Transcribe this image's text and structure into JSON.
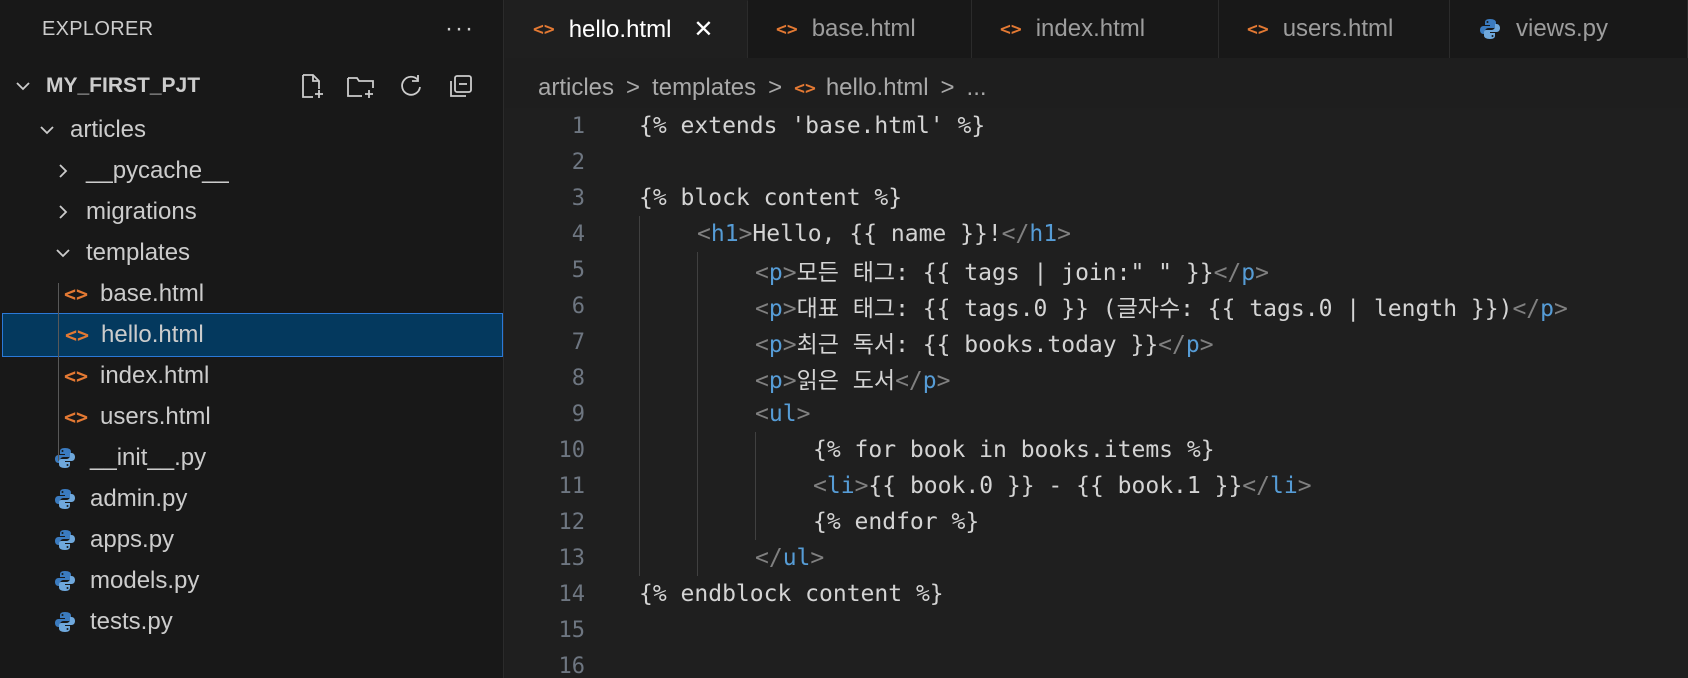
{
  "explorer": {
    "title": "EXPLORER",
    "more": "···",
    "project": "MY_FIRST_PJT",
    "actions": [
      "new-file-icon",
      "new-folder-icon",
      "refresh-icon",
      "collapse-all-icon"
    ],
    "tree": [
      {
        "label": "articles",
        "type": "folder-open",
        "indent": 1
      },
      {
        "label": "__pycache__",
        "type": "folder-closed",
        "indent": 2
      },
      {
        "label": "migrations",
        "type": "folder-closed",
        "indent": 2
      },
      {
        "label": "templates",
        "type": "folder-open",
        "indent": 2
      },
      {
        "label": "base.html",
        "type": "html",
        "indent": 3
      },
      {
        "label": "hello.html",
        "type": "html",
        "indent": 3,
        "selected": true
      },
      {
        "label": "index.html",
        "type": "html",
        "indent": 3
      },
      {
        "label": "users.html",
        "type": "html",
        "indent": 3
      },
      {
        "label": "__init__.py",
        "type": "py",
        "indent": 2
      },
      {
        "label": "admin.py",
        "type": "py",
        "indent": 2
      },
      {
        "label": "apps.py",
        "type": "py",
        "indent": 2
      },
      {
        "label": "models.py",
        "type": "py",
        "indent": 2
      },
      {
        "label": "tests.py",
        "type": "py",
        "indent": 2
      }
    ]
  },
  "tabs": [
    {
      "label": "hello.html",
      "type": "html",
      "active": true,
      "close": "✕"
    },
    {
      "label": "base.html",
      "type": "html"
    },
    {
      "label": "index.html",
      "type": "html"
    },
    {
      "label": "users.html",
      "type": "html"
    },
    {
      "label": "views.py",
      "type": "py"
    }
  ],
  "breadcrumb": {
    "parts": [
      "articles",
      "templates"
    ],
    "file": "hello.html",
    "tail": "...",
    "sep": ">"
  },
  "editor": {
    "lines": [
      {
        "n": "1",
        "indent": 0,
        "tokens": [
          [
            "t",
            "{% extends 'base.html' %}"
          ]
        ]
      },
      {
        "n": "2",
        "indent": 0,
        "tokens": []
      },
      {
        "n": "3",
        "indent": 0,
        "tokens": [
          [
            "t",
            "{% block content %}"
          ]
        ]
      },
      {
        "n": "4",
        "indent": 1,
        "tokens": [
          [
            "b",
            "<"
          ],
          [
            "g",
            "h1"
          ],
          [
            "b",
            ">"
          ],
          [
            "t",
            "Hello, {{ name }}!"
          ],
          [
            "b",
            "</"
          ],
          [
            "g",
            "h1"
          ],
          [
            "b",
            ">"
          ]
        ]
      },
      {
        "n": "5",
        "indent": 2,
        "tokens": [
          [
            "b",
            "<"
          ],
          [
            "g",
            "p"
          ],
          [
            "b",
            ">"
          ],
          [
            "t",
            "모든 태그: {{ tags | join:\" \" }}"
          ],
          [
            "b",
            "</"
          ],
          [
            "g",
            "p"
          ],
          [
            "b",
            ">"
          ]
        ]
      },
      {
        "n": "6",
        "indent": 2,
        "tokens": [
          [
            "b",
            "<"
          ],
          [
            "g",
            "p"
          ],
          [
            "b",
            ">"
          ],
          [
            "t",
            "대표 태그: {{ tags.0 }} (글자수: {{ tags.0 | length }})"
          ],
          [
            "b",
            "</"
          ],
          [
            "g",
            "p"
          ],
          [
            "b",
            ">"
          ]
        ]
      },
      {
        "n": "7",
        "indent": 2,
        "tokens": [
          [
            "b",
            "<"
          ],
          [
            "g",
            "p"
          ],
          [
            "b",
            ">"
          ],
          [
            "t",
            "최근 독서: {{ books.today }}"
          ],
          [
            "b",
            "</"
          ],
          [
            "g",
            "p"
          ],
          [
            "b",
            ">"
          ]
        ]
      },
      {
        "n": "8",
        "indent": 2,
        "tokens": [
          [
            "b",
            "<"
          ],
          [
            "g",
            "p"
          ],
          [
            "b",
            ">"
          ],
          [
            "t",
            "읽은 도서"
          ],
          [
            "b",
            "</"
          ],
          [
            "g",
            "p"
          ],
          [
            "b",
            ">"
          ]
        ]
      },
      {
        "n": "9",
        "indent": 2,
        "tokens": [
          [
            "b",
            "<"
          ],
          [
            "g",
            "ul"
          ],
          [
            "b",
            ">"
          ]
        ]
      },
      {
        "n": "10",
        "indent": 3,
        "tokens": [
          [
            "t",
            "{% for book in books.items %}"
          ]
        ]
      },
      {
        "n": "11",
        "indent": 3,
        "tokens": [
          [
            "b",
            "<"
          ],
          [
            "g",
            "li"
          ],
          [
            "b",
            ">"
          ],
          [
            "t",
            "{{ book.0 }} - {{ book.1 }}"
          ],
          [
            "b",
            "</"
          ],
          [
            "g",
            "li"
          ],
          [
            "b",
            ">"
          ]
        ]
      },
      {
        "n": "12",
        "indent": 3,
        "tokens": [
          [
            "t",
            "{% endfor %}"
          ]
        ]
      },
      {
        "n": "13",
        "indent": 2,
        "tokens": [
          [
            "b",
            "</"
          ],
          [
            "g",
            "ul"
          ],
          [
            "b",
            ">"
          ]
        ]
      },
      {
        "n": "14",
        "indent": 0,
        "tokens": [
          [
            "t",
            "{% endblock content %}"
          ]
        ]
      },
      {
        "n": "15",
        "indent": 0,
        "tokens": []
      },
      {
        "n": "16",
        "indent": 0,
        "tokens": []
      }
    ]
  },
  "colors": {
    "html_icon": "#e37933",
    "python_icon": "#519aba",
    "tag": "#569cd6",
    "selection": "#04395e"
  }
}
